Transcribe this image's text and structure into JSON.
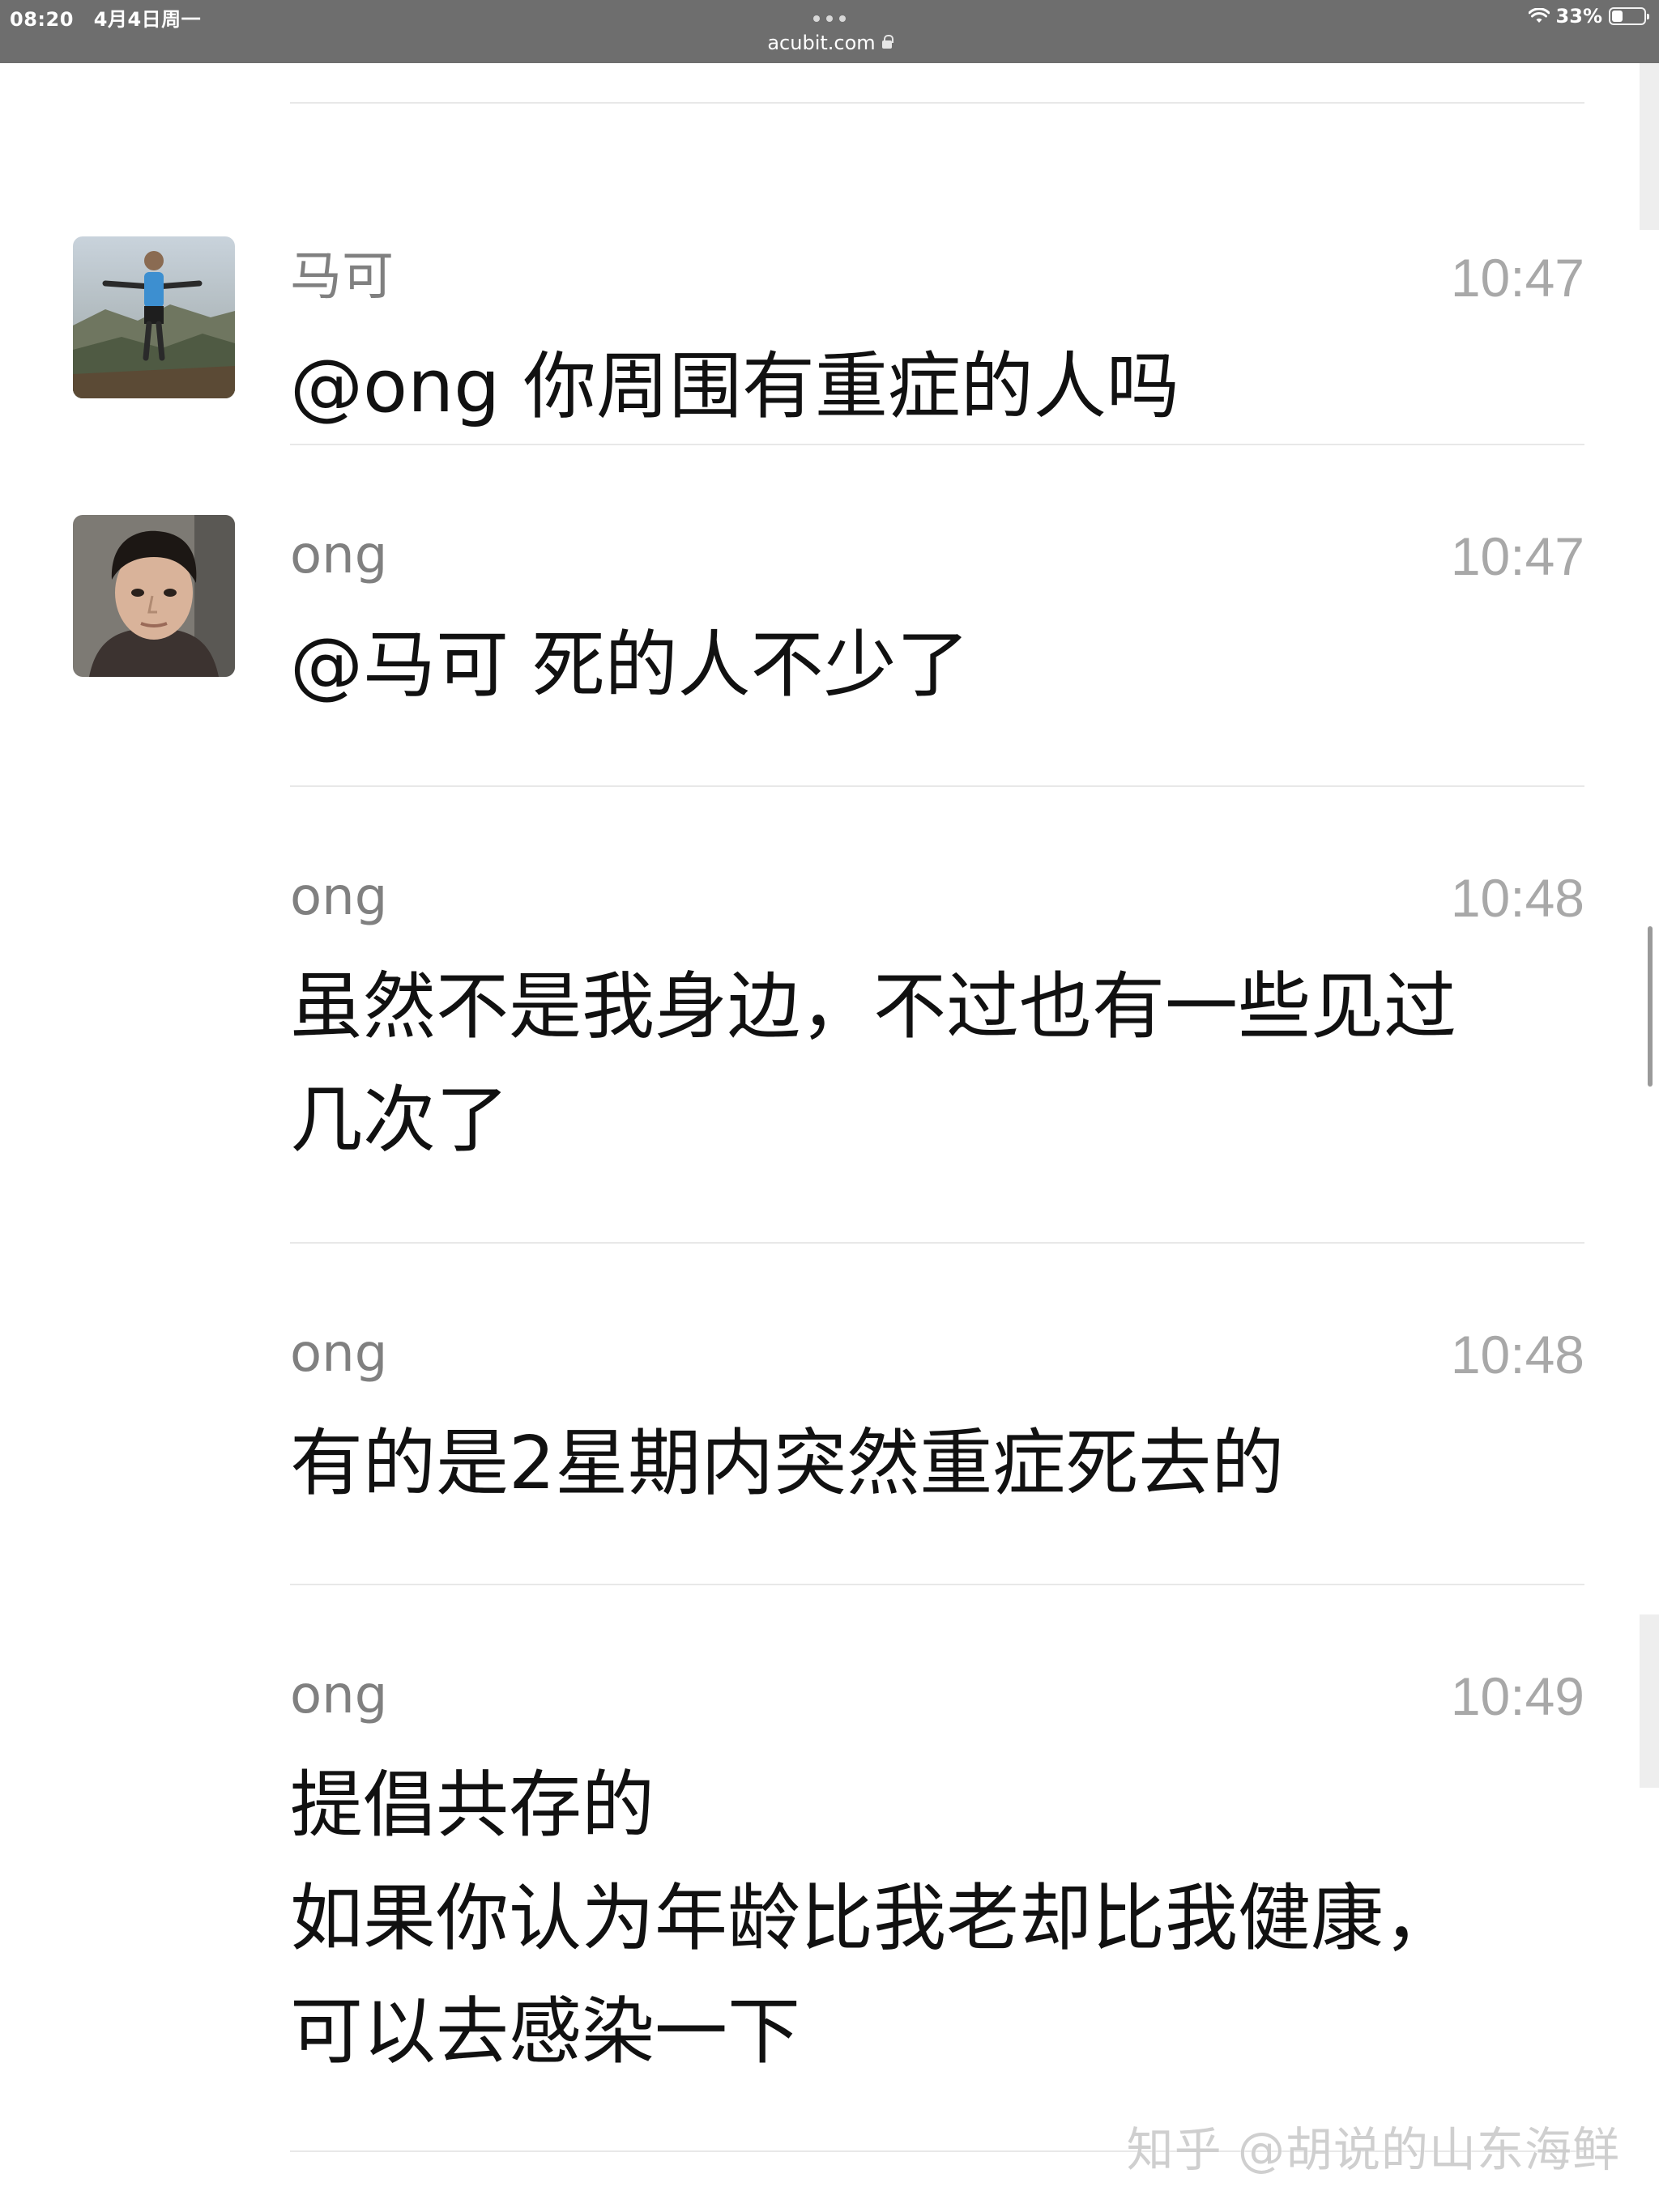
{
  "status_bar": {
    "time": "08:20",
    "date": "4月4日周一",
    "url": "acubit.com",
    "battery_percent": "33%",
    "battery_level": 0.33
  },
  "messages": [
    {
      "sender": "马可",
      "time": "10:47",
      "lines": [
        "@ong   你周围有重症的人吗"
      ],
      "has_avatar": true,
      "avatar": "person-standing-outdoors-avatar"
    },
    {
      "sender": "ong",
      "time": "10:47",
      "lines": [
        "@马可 死的人不少了"
      ],
      "has_avatar": true,
      "avatar": "man-face-avatar"
    },
    {
      "sender": "ong",
      "time": "10:48",
      "lines": [
        "虽然不是我身边，不过也有一些见过",
        "几次了"
      ],
      "has_avatar": false
    },
    {
      "sender": "ong",
      "time": "10:48",
      "lines": [
        "有的是2星期内突然重症死去的"
      ],
      "has_avatar": false
    },
    {
      "sender": "ong",
      "time": "10:49",
      "lines": [
        "提倡共存的",
        "如果你认为年龄比我老却比我健康，",
        "可以去感染一下"
      ],
      "has_avatar": false
    }
  ],
  "watermark": "知乎 @胡说的山东海鲜"
}
